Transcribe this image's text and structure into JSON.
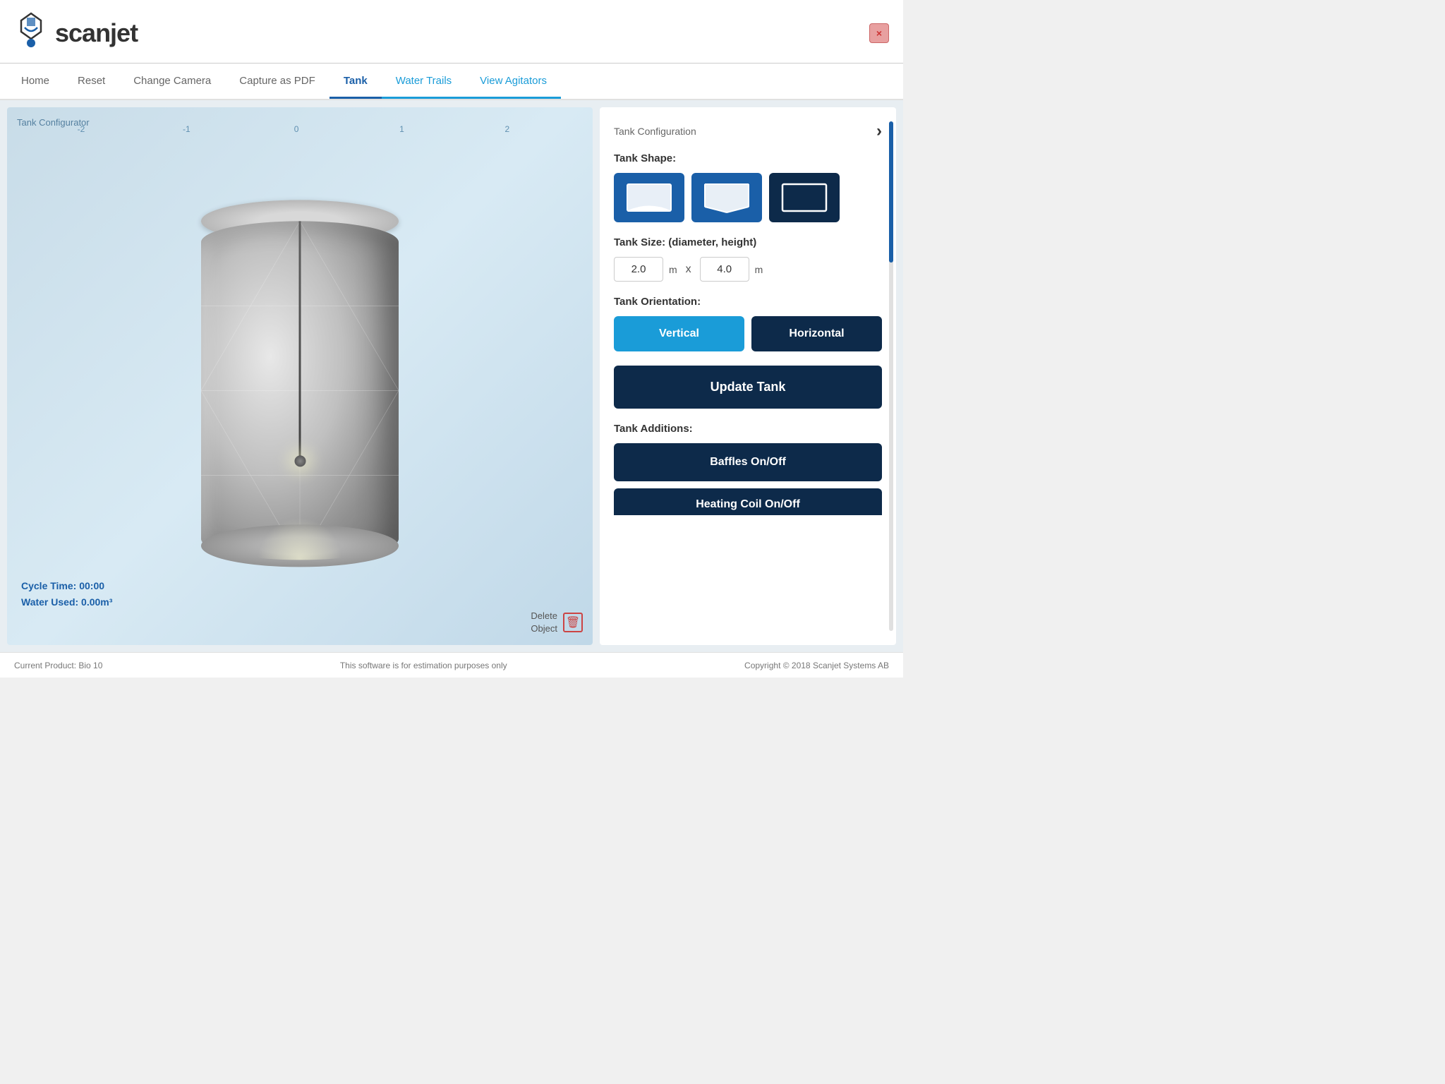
{
  "app": {
    "title": "Scanjet",
    "logo_text": "scanjet"
  },
  "header": {
    "close_label": "×"
  },
  "nav": {
    "items": [
      {
        "id": "home",
        "label": "Home",
        "active": false
      },
      {
        "id": "reset",
        "label": "Reset",
        "active": false
      },
      {
        "id": "change-camera",
        "label": "Change Camera",
        "active": false
      },
      {
        "id": "capture-pdf",
        "label": "Capture as PDF",
        "active": false
      },
      {
        "id": "tank",
        "label": "Tank",
        "active": true
      },
      {
        "id": "water-trails",
        "label": "Water Trails",
        "active": false,
        "blue": true
      },
      {
        "id": "view-agitators",
        "label": "View Agitators",
        "active": false,
        "blue": true
      }
    ]
  },
  "viewport": {
    "label": "Tank Configurator",
    "ruler_marks": [
      "-2",
      "-1",
      "0",
      "1",
      "2"
    ],
    "cycle_time_label": "Cycle Time: 00:00",
    "water_used_label": "Water Used: 0.00m³",
    "delete_label": "Delete\nObject"
  },
  "panel": {
    "title": "Tank Configuration",
    "next_icon": "›",
    "tank_shape_label": "Tank Shape:",
    "shapes": [
      {
        "id": "concave-bottom",
        "name": "concave-bottom"
      },
      {
        "id": "v-bottom",
        "name": "v-bottom"
      },
      {
        "id": "flat-bottom",
        "name": "flat-bottom"
      }
    ],
    "tank_size_label": "Tank Size: (diameter, height)",
    "diameter_value": "2.0",
    "diameter_unit": "m",
    "separator": "x",
    "height_value": "4.0",
    "height_unit": "m",
    "orientation_label": "Tank Orientation:",
    "vertical_label": "Vertical",
    "horizontal_label": "Horizontal",
    "update_tank_label": "Update Tank",
    "additions_label": "Tank Additions:",
    "baffles_label": "Baffles On/Off",
    "heating_coil_label": "Heating Coil On/Off"
  },
  "footer": {
    "product_label": "Current Product: Bio 10",
    "disclaimer": "This software is for estimation purposes only",
    "copyright": "Copyright © 2018 Scanjet Systems AB"
  }
}
